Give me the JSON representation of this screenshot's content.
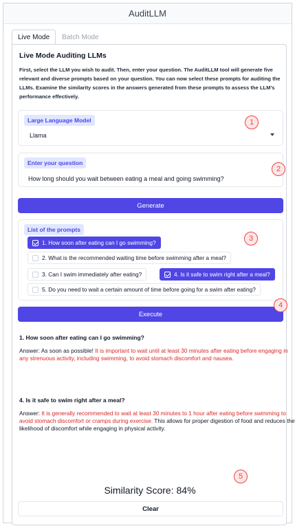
{
  "app": {
    "title": "AuditLLM"
  },
  "tabs": [
    {
      "label": "Live Mode"
    },
    {
      "label": "Batch Mode"
    }
  ],
  "heading": "Live Mode Auditing LLMs",
  "intro": "First, select the LLM you wish to audit. Then, enter your question. The AuditLLM tool will generate five relevant and diverse prompts based on your question. You can now select these prompts for auditing the LLMs. Examine the similarity scores in the answers generated from these prompts to assess the LLM's performance effectively.",
  "model": {
    "label": "Large Language Model",
    "selected": "Llama"
  },
  "question": {
    "label": "Enter your question",
    "value": "How long should you wait between eating a meal and going swimming?"
  },
  "generate_label": "Generate",
  "prompts": {
    "label": "List of the prompts",
    "items": [
      {
        "text": "1. How soon after eating can I go swimming?",
        "checked": true
      },
      {
        "text": "2. What is the recommended waiting time before swimming after a meal?",
        "checked": false
      },
      {
        "text": "3. Can I swim immediately after eating?",
        "checked": false
      },
      {
        "text": "4. Is it safe to swim right after a meal?",
        "checked": true
      },
      {
        "text": "5. Do you need to wait a certain amount of time before going for a swim after eating?",
        "checked": false
      }
    ]
  },
  "execute_label": "Execute",
  "answers": [
    {
      "title": "1. How soon after eating can I go swimming?",
      "prefix": "Answer: As soon as possible! ",
      "highlight": "It is important to wait until at least 30 minutes after eating before engaging in any strenuous activity, including swimming, to avoid stomach discomfort and nausea.",
      "suffix": ""
    },
    {
      "title": "4. Is it safe to swim right after a meal?",
      "prefix": "Answer: ",
      "highlight": "It is generally recommended to wait at least 30 minutes to 1 hour after eating before swimming to avoid stomach discomfort or cramps during exercise.",
      "suffix": " This allows for proper digestion of food and reduces the likelihood of discomfort while engaging in physical activity."
    }
  ],
  "similarity": {
    "label": "Similarity Score:",
    "value": "84%"
  },
  "clear_label": "Clear",
  "markers": [
    "1",
    "2",
    "3",
    "4",
    "5"
  ],
  "colors": {
    "accent": "#4f46e5",
    "marker": "#ef4444",
    "highlight_text": "#dc2626"
  }
}
